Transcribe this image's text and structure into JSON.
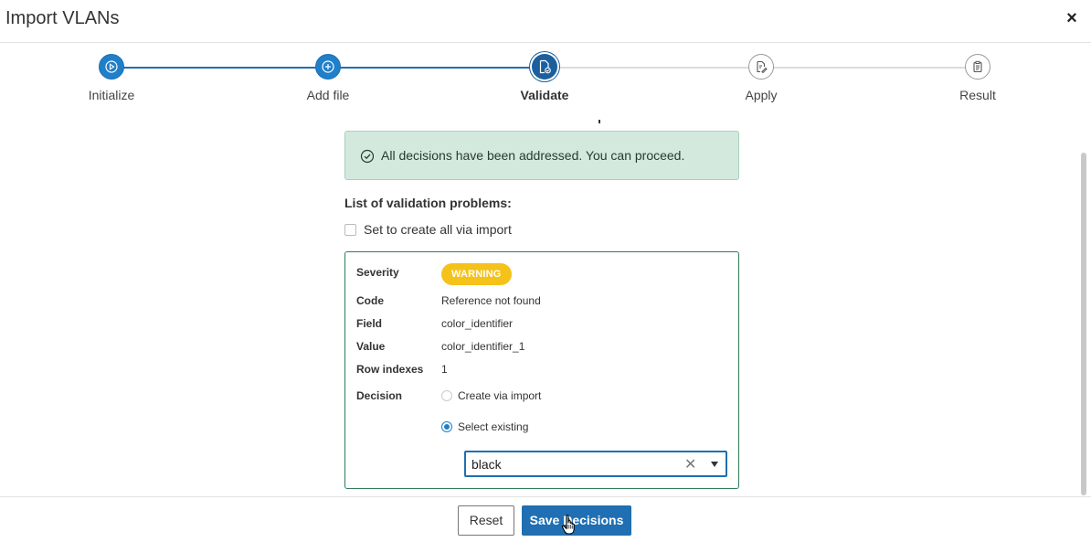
{
  "header": {
    "title": "Import VLANs",
    "close_label": "×"
  },
  "stepper": {
    "steps": [
      {
        "label": "Initialize",
        "state": "done",
        "icon": "play-icon"
      },
      {
        "label": "Add file",
        "state": "done",
        "icon": "plus-circle-icon"
      },
      {
        "label": "Validate",
        "state": "active",
        "icon": "file-check-icon"
      },
      {
        "label": "Apply",
        "state": "todo",
        "icon": "file-edit-icon"
      },
      {
        "label": "Result",
        "state": "todo",
        "icon": "clipboard-icon"
      }
    ]
  },
  "alert": {
    "icon": "check-circle-icon",
    "text": "All decisions have been addressed. You can proceed."
  },
  "validation": {
    "heading": "List of validation problems:",
    "create_all_label": "Set to create all via import",
    "create_all_checked": false,
    "problem": {
      "severity_label": "Severity",
      "severity_value": "WARNING",
      "code_label": "Code",
      "code_value": "Reference not found",
      "field_label": "Field",
      "field_value": "color_identifier",
      "value_label": "Value",
      "value_value": "color_identifier_1",
      "rows_label": "Row indexes",
      "rows_value": "1",
      "decision_label": "Decision",
      "options": [
        {
          "label": "Create via import",
          "selected": false
        },
        {
          "label": "Select existing",
          "selected": true
        }
      ],
      "selected_value": "black",
      "clear_label": "✕"
    }
  },
  "footer": {
    "reset_label": "Reset",
    "save_label": "Save Decisions"
  },
  "colors": {
    "primary": "#1f6fb2",
    "warning": "#f5c21a",
    "success_bg": "#d3e9de",
    "card_border": "#2e7d5b"
  }
}
